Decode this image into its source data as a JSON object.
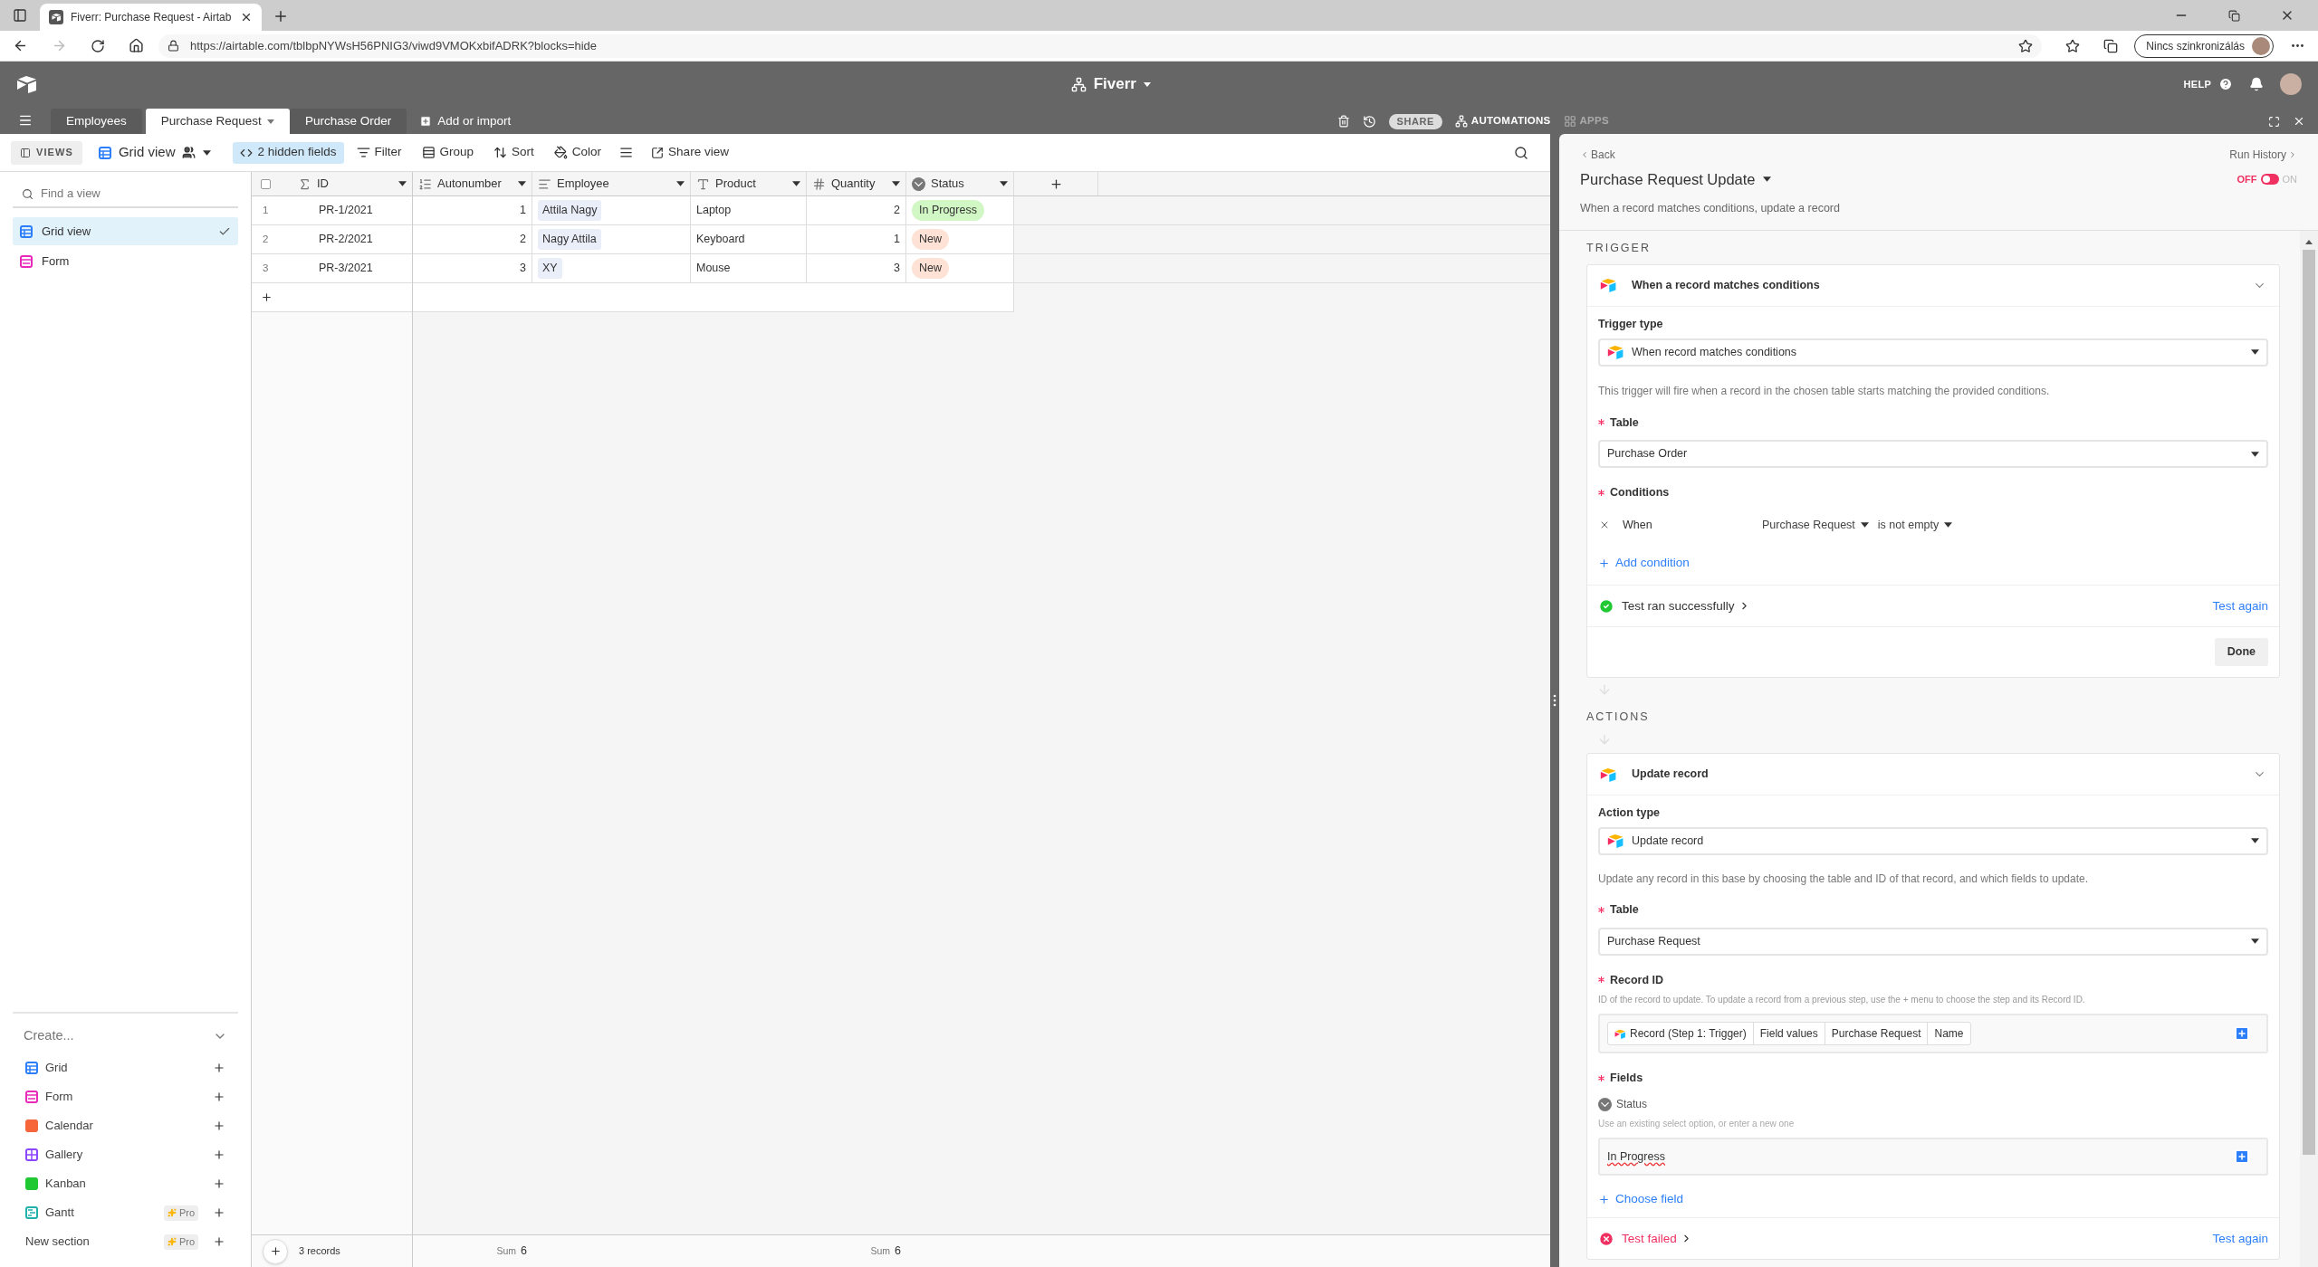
{
  "browser": {
    "tab_title": "Fiverr: Purchase Request - Airtab",
    "url": "https://airtable.com/tblbpNYWsH56PNIG3/viwd9VMOKxbifADRK?blocks=hide",
    "profile_label": "Nincs szinkronizálás"
  },
  "header": {
    "base_name": "Fiverr",
    "help": "HELP"
  },
  "tables": [
    {
      "label": "Employees",
      "selected": false
    },
    {
      "label": "Purchase Request",
      "selected": true
    },
    {
      "label": "Purchase Order",
      "selected": false
    }
  ],
  "add_table": "Add or import",
  "top_actions": {
    "share": "SHARE",
    "automations": "AUTOMATIONS",
    "apps": "APPS"
  },
  "view_bar": {
    "views_label": "VIEWS",
    "view_name": "Grid view",
    "hidden_fields": "2 hidden fields",
    "tools": [
      {
        "kind": "filter",
        "label": "Filter"
      },
      {
        "kind": "group",
        "label": "Group"
      },
      {
        "kind": "sort",
        "label": "Sort"
      },
      {
        "kind": "color",
        "label": "Color"
      }
    ],
    "share_view": "Share view"
  },
  "sidebar": {
    "search_placeholder": "Find a view",
    "views": [
      {
        "label": "Grid view",
        "kind": "grid",
        "selected": true
      },
      {
        "label": "Form",
        "kind": "form",
        "selected": false
      }
    ],
    "create_label": "Create...",
    "create_items": [
      {
        "label": "Grid",
        "kind": "grid"
      },
      {
        "label": "Form",
        "kind": "form"
      },
      {
        "label": "Calendar",
        "kind": "calendar"
      },
      {
        "label": "Gallery",
        "kind": "gallery"
      },
      {
        "label": "Kanban",
        "kind": "kanban"
      },
      {
        "label": "Gantt",
        "kind": "gantt",
        "badge": "Pro"
      },
      {
        "label": "New section",
        "kind": "section",
        "badge": "Pro"
      }
    ]
  },
  "table": {
    "columns": [
      {
        "name": "ID",
        "kind": "formula"
      },
      {
        "name": "Autonumber",
        "kind": "autonumber",
        "sum": {
          "label": "Sum",
          "value": "6"
        }
      },
      {
        "name": "Employee",
        "kind": "link"
      },
      {
        "name": "Product",
        "kind": "text"
      },
      {
        "name": "Quantity",
        "kind": "number",
        "sum": {
          "label": "Sum",
          "value": "6"
        }
      },
      {
        "name": "Status",
        "kind": "select"
      }
    ],
    "select_all_checked": false,
    "rows": [
      {
        "number": "1",
        "id": "PR-1/2021",
        "autonumber": "1",
        "employee": "Attila Nagy",
        "product": "Laptop",
        "quantity": "2",
        "status": {
          "label": "In Progress",
          "color": "#d1f7c4"
        }
      },
      {
        "number": "2",
        "id": "PR-2/2021",
        "autonumber": "2",
        "employee": "Nagy Attila",
        "product": "Keyboard",
        "quantity": "1",
        "status": {
          "label": "New",
          "color": "#fee2d5"
        }
      },
      {
        "number": "3",
        "id": "PR-3/2021",
        "autonumber": "3",
        "employee": "XY",
        "product": "Mouse",
        "quantity": "3",
        "status": {
          "label": "New",
          "color": "#fee2d5"
        }
      }
    ],
    "records": "3 records"
  },
  "automation": {
    "back": "Back",
    "run_history": "Run History",
    "title": "Purchase Request Update",
    "subtitle": "When a record matches conditions, update a record",
    "toggle": {
      "off_label": "OFF",
      "on_label": "ON",
      "on": false
    },
    "trigger": {
      "section_label": "TRIGGER",
      "title": "When a record matches conditions",
      "type_label": "Trigger type",
      "type_value": "When record matches conditions",
      "type_hint": "This trigger will fire when a record in the chosen table starts matching the provided conditions.",
      "table_label": "Table",
      "table_value": "Purchase Order",
      "conditions_label": "Conditions",
      "conditions": [
        {
          "prefix": "When",
          "field": "Purchase Request",
          "operator": "is not empty"
        }
      ],
      "add_condition": "Add condition",
      "test": {
        "kind": "success",
        "label": "Test ran successfully",
        "again": "Test again"
      },
      "done": "Done"
    },
    "action": {
      "section_label": "ACTIONS",
      "title": "Update record",
      "type_label": "Action type",
      "type_value": "Update record",
      "type_hint": "Update any record in this base by choosing the table and ID of that record, and which fields to update.",
      "table_label": "Table",
      "table_value": "Purchase Request",
      "record_id_label": "Record ID",
      "record_id_hint": "ID of the record to update. To update a record from a previous step, use the + menu to choose the step and its Record ID.",
      "tokens": [
        "Record (Step 1: Trigger)",
        "Field values",
        "Purchase Request",
        "Name"
      ],
      "fields_label": "Fields",
      "fields": [
        {
          "name": "Status",
          "hint": "Use an existing select option, or enter a new one",
          "value": "In Progress"
        }
      ],
      "choose_field": "Choose field",
      "test": {
        "kind": "failure",
        "label": "Test failed",
        "again": "Test again"
      }
    }
  }
}
